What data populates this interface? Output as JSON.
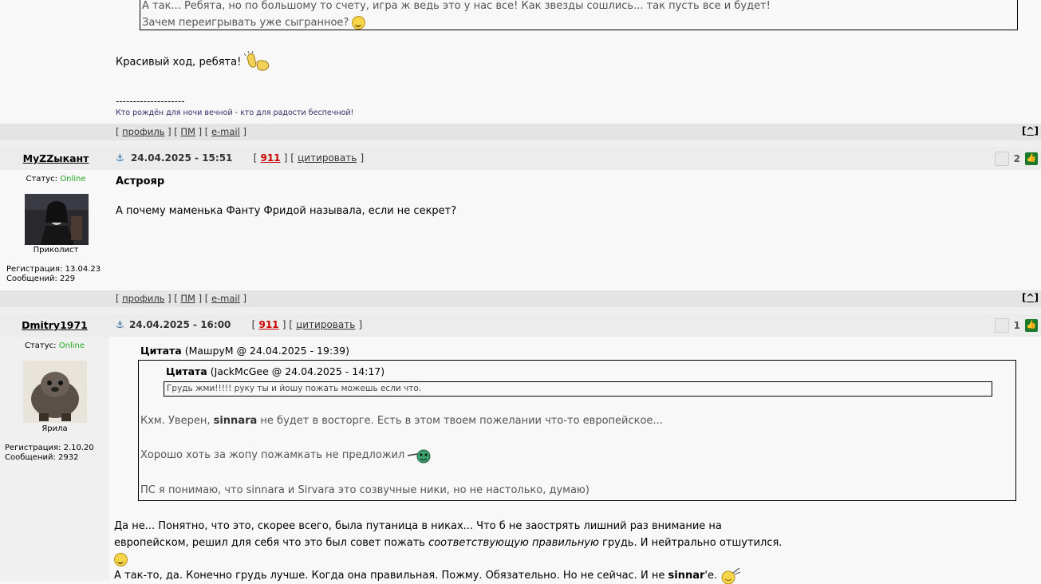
{
  "colors": {
    "online": "#22aa22",
    "red_link": "#cc0000",
    "bar": "#e4e4e4",
    "like_green": "#1a7a2a"
  },
  "top_post": {
    "quote_line1": "А так... Ребята, но по большому то счету, игра ж ведь это у нас все! Как звезды сошлись... так пусть все и будет!",
    "quote_line2": "Зачем переигрывать уже сыгранное?",
    "message": "Красивый ход, ребята!",
    "sig_dashes": "--------------------",
    "sig_text": "Кто рождён для ночи вечной - кто для радости беспечной!"
  },
  "links": {
    "open": "[",
    "profile": "профиль",
    "mid": "] [",
    "pm": "ПМ",
    "email": "e-mail",
    "close": "]",
    "top": "[^]"
  },
  "post2": {
    "nick": "MyZZыкант",
    "status_label": "Статус:",
    "status": "Online",
    "rank": "Приколист",
    "reg": "Регистрация: 13.04.23",
    "msgs": "Сообщений: 229",
    "date": "24.04.2025 - 15:51",
    "num": "911",
    "cite": "цитировать",
    "votes": "2",
    "addressee": "Астрояр",
    "text": "А почему маменька Фанту Фридой называла, если не секрет?"
  },
  "post3": {
    "nick": "Dmitry1971",
    "status_label": "Статус:",
    "status": "Online",
    "rank": "Ярила",
    "reg": "Регистрация: 2.10.20",
    "msgs": "Сообщений: 2932",
    "date": "24.04.2025 - 16:00",
    "num": "911",
    "cite": "цитировать",
    "votes": "1",
    "quote_label": "Цитата",
    "quote_src": "(МашруМ @ 24.04.2025 - 19:39)",
    "inner_quote_src": "(JackMcGee @ 24.04.2025 - 14:17)",
    "inner_quote_text": "Грудь жми!!!!! руку ты и йошу пожать можешь если что.",
    "q_line1_a": "Кхм. Уверен,",
    "q_bold": "sinnara",
    "q_line1_b": "не будет в восторге. Есть в этом твоем пожелании что-то европейское...",
    "q_line2": "Хорошо хоть за жопу пожамкать не предложил",
    "q_line3": "ПС я понимаю, что sinnara и Sirvara это созвучные ники, но не настолько, думаю)",
    "body_line1": "Да не... Понятно, что это, скорее всего, была путаница в никах... Что б не заострять лишний раз внимание на",
    "body_line2_a": "европейском, решил для себя что это был совет пожать",
    "body_line2_em": "соответствующую правильную",
    "body_line2_b": "грудь. И нейтрально отшутился.",
    "body_line3_a": "А так-то, да. Конечно грудь лучше. Когда она правильная. Пожму. Обязательно. Но не сейчас. И не",
    "body_line3_bold": "sinnar",
    "body_line3_b": "'е."
  }
}
